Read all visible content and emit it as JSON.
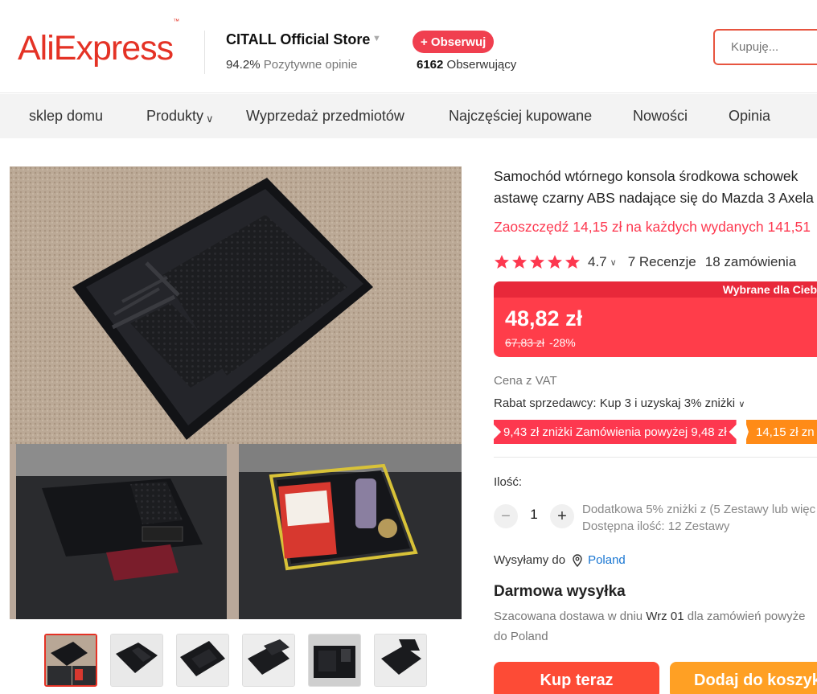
{
  "header": {
    "logo_text": "AliExpress",
    "logo_tm": "™",
    "store_name": "CITALL Official Store",
    "store_rating_value": "94.2%",
    "store_rating_label": "Pozytywne opinie",
    "follow_label": "+ Obserwuj",
    "followers_count": "6162",
    "followers_label": "Obserwujący",
    "search_placeholder": "Kupuję..."
  },
  "nav": {
    "items": [
      "sklep domu",
      "Produkty",
      "Wyprzedaż przedmiotów",
      "Najczęściej kupowane",
      "Nowości",
      "Opinia"
    ]
  },
  "product": {
    "title_line1": "Samochód wtórnego konsola środkowa schowek",
    "title_line2": "astawę czarny ABS nadające się do Mazda 3 Axela",
    "save_text": "Zaoszczędź 14,15 zł na każdych wydanych 141,51",
    "rating": "4.7",
    "rating_stars": 5,
    "reviews": "7 Recenzje",
    "orders": "18 zamówienia",
    "badge": "Wybrane dla Cieb",
    "price": "48,82 zł",
    "old_price": "67,83 zł",
    "discount": "-28%",
    "vat": "Cena z VAT",
    "seller_discount": "Rabat sprzedawcy: Kup 3 i uzyskaj 3% zniżki",
    "coupons": [
      "9,43 zł zniżki Zamówienia powyżej 9,48 zł",
      "14,15 zł zn"
    ],
    "qty_label": "Ilość:",
    "qty_value": "1",
    "qty_note_line1": "Dodatkowa 5% zniżki z (5 Zestawy lub więc",
    "qty_note_line2": "Dostępna ilość: 12 Zestawy",
    "ship_to_label": "Wysyłamy do",
    "ship_country": "Poland",
    "free_shipping": "Darmowa wysyłka",
    "delivery_prefix": "Szacowana dostawa w dniu",
    "delivery_date": "Wrz 01",
    "delivery_suffix": "dla zamówień powyże",
    "delivery_line2": "do Poland",
    "buy_now": "Kup teraz",
    "add_to_cart": "Dodaj do koszyk"
  },
  "colors": {
    "brand": "#e43225",
    "price_red": "#fd384f",
    "buy": "#fd4b36",
    "cart": "#ffa024",
    "link": "#1976d2"
  }
}
